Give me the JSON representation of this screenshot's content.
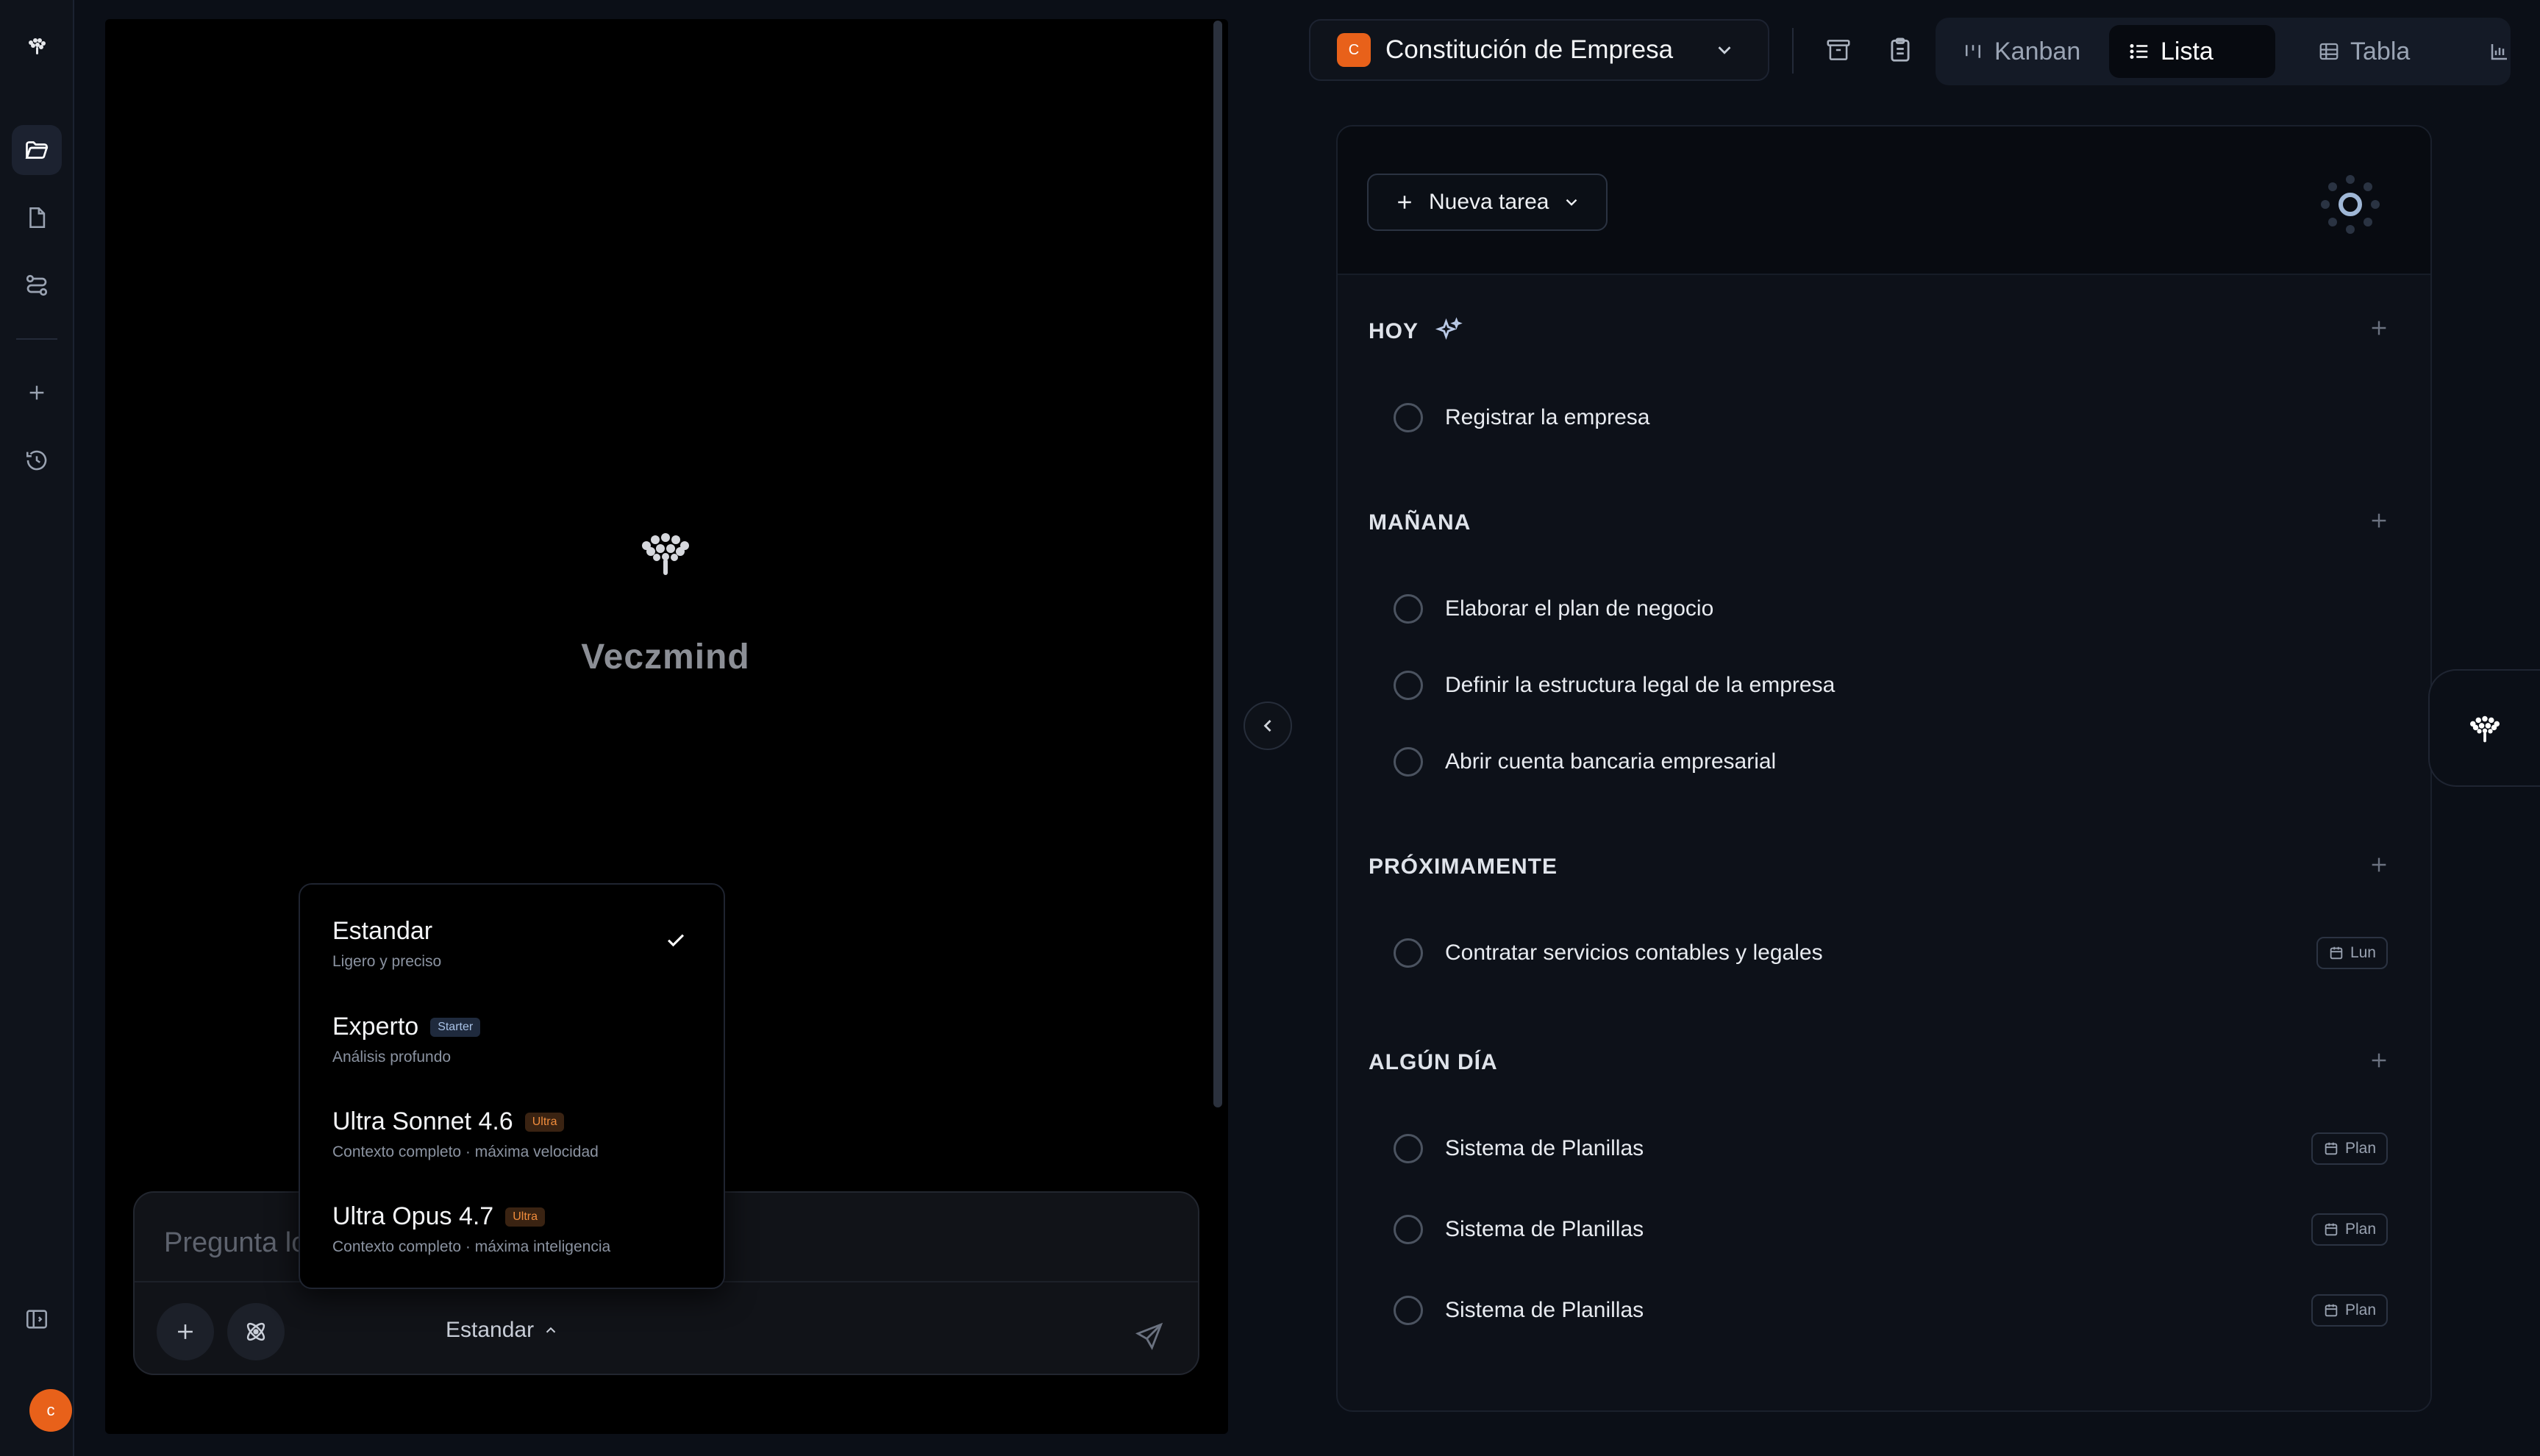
{
  "app": {
    "brand_name": "Veczmind",
    "user_initial": "c"
  },
  "rail": {
    "items": [
      {
        "name": "folder-icon",
        "active": true
      },
      {
        "name": "document-icon",
        "active": false
      },
      {
        "name": "workflow-icon",
        "active": false
      },
      {
        "name": "plus-icon",
        "active": false
      },
      {
        "name": "history-icon",
        "active": false
      },
      {
        "name": "sidebar-toggle-icon",
        "active": false
      }
    ]
  },
  "chat": {
    "placeholder": "Pregunta lo",
    "model_selected": "Estandar"
  },
  "model_menu": {
    "items": [
      {
        "title": "Estandar",
        "subtitle": "Ligero y preciso",
        "badge": "",
        "selected": true
      },
      {
        "title": "Experto",
        "subtitle": "Análisis profundo",
        "badge": "Starter",
        "selected": false
      },
      {
        "title": "Ultra Sonnet 4.6",
        "subtitle": "Contexto completo · máxima velocidad",
        "badge": "Ultra",
        "selected": false
      },
      {
        "title": "Ultra Opus 4.7",
        "subtitle": "Contexto completo · máxima inteligencia",
        "badge": "Ultra",
        "selected": false
      }
    ]
  },
  "project": {
    "initial": "C",
    "name": "Constitución de Empresa",
    "accent": "#e8611a"
  },
  "views": {
    "tabs": [
      {
        "label": "Kanban",
        "icon": "kanban-icon",
        "active": false
      },
      {
        "label": "Lista",
        "icon": "list-icon",
        "active": true
      },
      {
        "label": "Tabla",
        "icon": "table-icon",
        "active": false
      },
      {
        "label": "",
        "icon": "chart-icon",
        "active": false
      }
    ]
  },
  "tasks": {
    "new_task_label": "Nueva tarea",
    "sections": [
      {
        "title": "HOY",
        "items": [
          {
            "text": "Registrar la empresa",
            "tag": ""
          }
        ]
      },
      {
        "title": "MAÑANA",
        "items": [
          {
            "text": "Elaborar el plan de negocio",
            "tag": ""
          },
          {
            "text": "Definir la estructura legal de la empresa",
            "tag": ""
          },
          {
            "text": "Abrir cuenta bancaria empresarial",
            "tag": ""
          }
        ]
      },
      {
        "title": "PRÓXIMAMENTE",
        "items": [
          {
            "text": "Contratar servicios contables y legales",
            "tag": "Lun"
          }
        ]
      },
      {
        "title": "ALGÚN DÍA",
        "items": [
          {
            "text": "Sistema de Planillas",
            "tag": "Plan"
          },
          {
            "text": "Sistema de Planillas",
            "tag": "Plan"
          },
          {
            "text": "Sistema de Planillas",
            "tag": "Plan"
          }
        ]
      }
    ]
  }
}
